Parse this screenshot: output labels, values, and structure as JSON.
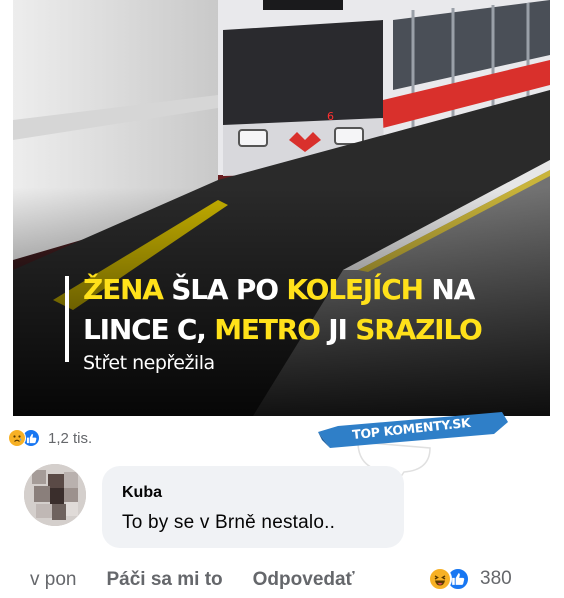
{
  "post": {
    "headline": {
      "line1_part1": "Žena",
      "line1_part2": " šla po ",
      "line1_part3": "kolejích",
      "line1_part4": " na",
      "line2_part1": "lince C, ",
      "line2_part2": "metro",
      "line2_part3": " ji ",
      "line2_part4": "srazilo",
      "subtitle": "Střet nepřežila"
    },
    "train_number": "6",
    "reactions": {
      "icons": [
        "sad-icon",
        "like-icon"
      ],
      "count": "1,2 tis."
    }
  },
  "watermark": {
    "text": "TOP KOMENTY.SK"
  },
  "comment": {
    "author": "Kuba",
    "text": "To by se v Brně nestalo..",
    "time": "v pon",
    "like_label": "Páči sa mi to",
    "reply_label": "Odpovedať",
    "reactions": {
      "icons": [
        "haha-icon",
        "like-icon"
      ],
      "count": "380"
    }
  },
  "colors": {
    "headline_highlight": "#ffe11a",
    "train_red": "#d9302c",
    "like_blue": "#1877f2",
    "reaction_yellow": "#f7b125",
    "badge_blue": "#2f7fc8",
    "bubble_bg": "#f0f2f5"
  }
}
